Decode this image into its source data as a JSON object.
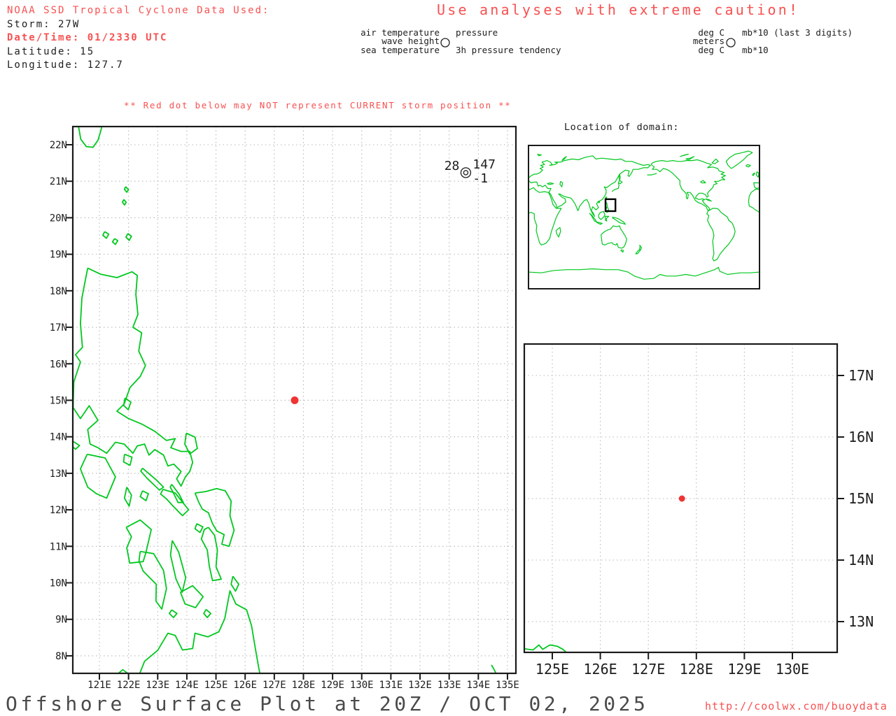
{
  "colors": {
    "accent_red": "#f85151",
    "storm_dot_red": "#ef3434",
    "coast_green": "#00c81e",
    "grid_gray": "#b8b8b8",
    "axis_black": "#1a1a1a",
    "title_gray": "#4a4a4a"
  },
  "header": {
    "info_lines": [
      {
        "text": "NOAA SSD Tropical Cyclone Data Used:",
        "style": "red"
      },
      {
        "text": "Storm: 27W",
        "style": "black"
      },
      {
        "text": "Date/Time: 01/2330 UTC",
        "style": "red-bold"
      },
      {
        "text": "Latitude: 15",
        "style": "black"
      },
      {
        "text": "Longitude: 127.7",
        "style": "black"
      }
    ],
    "caution": "Use analyses with extreme caution!"
  },
  "station_legend": {
    "left_labels": [
      "air temperature",
      "wave height",
      "sea temperature"
    ],
    "right_labels": [
      "pressure",
      "",
      "3h pressure tendency"
    ],
    "units_left": [
      "deg C",
      "meters",
      "deg C"
    ],
    "units_right": [
      "mb*10 (last 3 digits)",
      "",
      "mb*10"
    ]
  },
  "warning": "** Red dot below may NOT represent CURRENT storm position **",
  "main_map": {
    "x_tick_labels": [
      "121E",
      "122E",
      "123E",
      "124E",
      "125E",
      "126E",
      "127E",
      "128E",
      "129E",
      "130E",
      "131E",
      "132E",
      "133E",
      "134E",
      "135E"
    ],
    "y_tick_labels": [
      "22N",
      "21N",
      "20N",
      "19N",
      "18N",
      "17N",
      "16N",
      "15N",
      "14N",
      "13N",
      "12N",
      "11N",
      "10N",
      "9N",
      "8N"
    ],
    "storm_dot": {
      "lon": 127.7,
      "lat": 15
    },
    "station": {
      "air_temperature": "28",
      "pressure": "147",
      "pressure_tendency": "-1",
      "lon": 133.57,
      "lat": 21.35
    }
  },
  "inset_map": {
    "title": "Location of domain:"
  },
  "zoom_map": {
    "x_tick_labels": [
      "125E",
      "126E",
      "127E",
      "128E",
      "129E",
      "130E"
    ],
    "y_tick_labels": [
      "17N",
      "16N",
      "15N",
      "14N",
      "13N"
    ],
    "storm_dot": {
      "lon": 127.7,
      "lat": 15
    }
  },
  "footer": {
    "title": "Offshore Surface Plot at 20Z / OCT 02, 2025",
    "url": "http://coolwx.com/buoydata"
  }
}
